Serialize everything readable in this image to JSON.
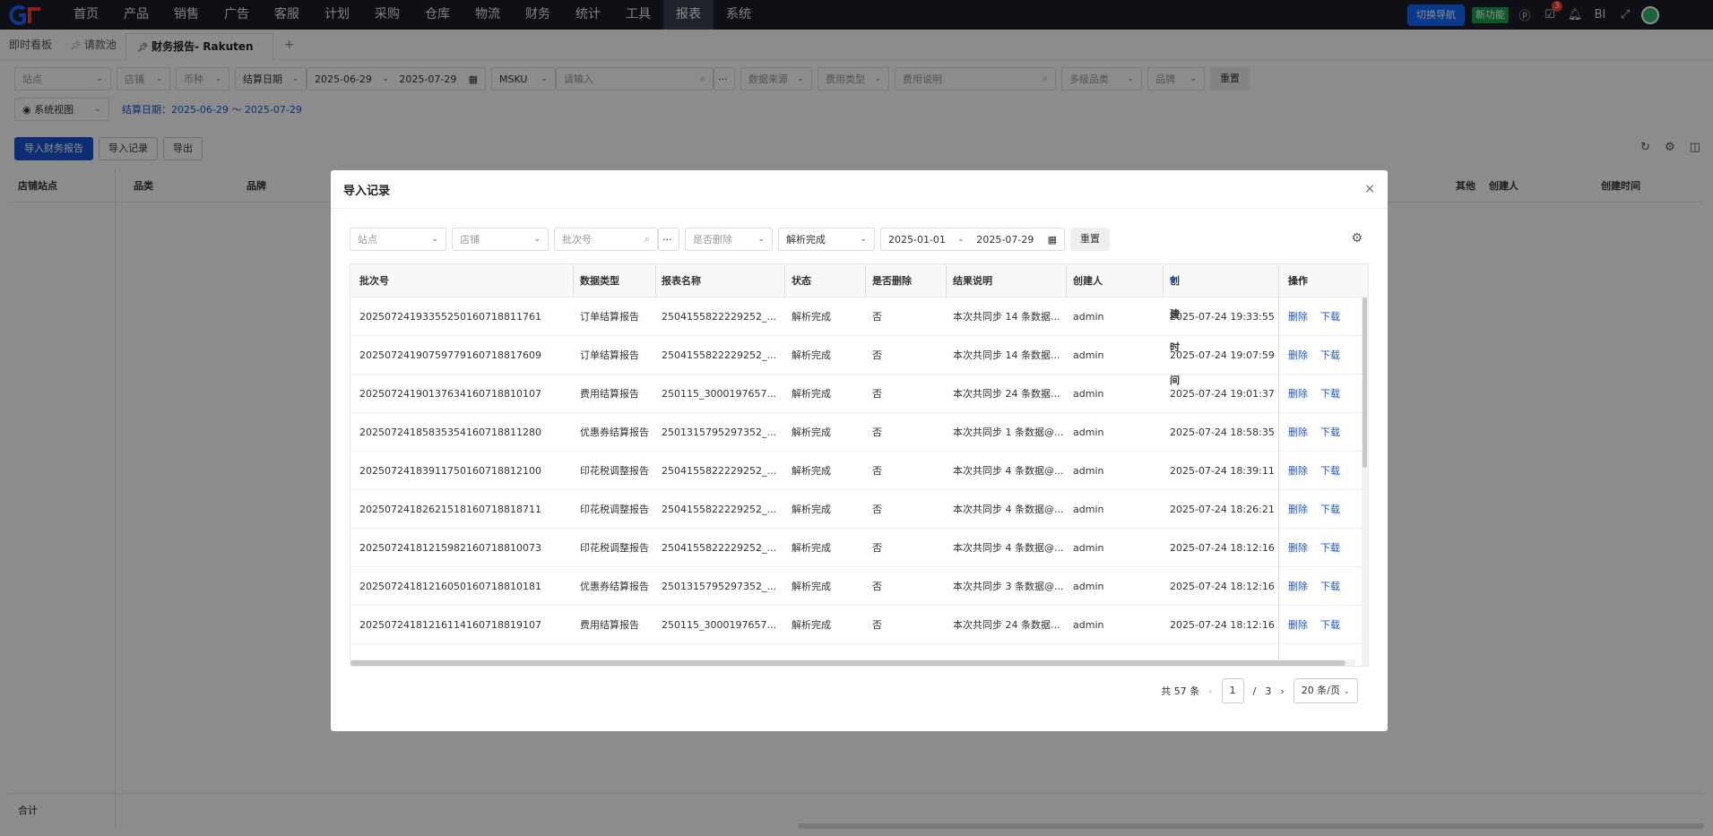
{
  "nav": {
    "items": [
      "首页",
      "产品",
      "销售",
      "广告",
      "客服",
      "计划",
      "采购",
      "仓库",
      "物流",
      "财务",
      "统计",
      "工具",
      "报表",
      "系统"
    ],
    "active": "报表",
    "switch_label": "切换导航",
    "new_label": "新功能",
    "badge_count": "3",
    "bi_label": "BI"
  },
  "tabs": {
    "items": [
      "即时看板",
      "请款池",
      "财务报告- Rakuten"
    ],
    "add": "+"
  },
  "filters": {
    "site": "站点",
    "shop": "店铺",
    "currency": "币种",
    "settle_date": "结算日期",
    "date_start": "2025-06-29",
    "date_sep": "-",
    "date_end": "2025-07-29",
    "msku": "MSKU",
    "msku_placeholder": "请输入",
    "data_source": "数据来源",
    "fee_type": "费用类型",
    "fee_desc": "费用说明",
    "category": "多级品类",
    "brand": "品牌",
    "reset": "重置",
    "system_view": "系统视图",
    "date_range_text": "结算日期：2025-06-29 ～ 2025-07-29"
  },
  "toolbar": {
    "import_report": "导入财务报告",
    "import_record": "导入记录",
    "export": "导出"
  },
  "main_table": {
    "headers": [
      "店铺站点",
      "品类",
      "品牌",
      "其他",
      "创建人",
      "创建时间"
    ],
    "sum_label": "合计"
  },
  "modal": {
    "title": "导入记录",
    "close": "×",
    "filters": {
      "site": "站点",
      "shop": "店铺",
      "batch_placeholder": "批次号",
      "is_deleted": "是否删除",
      "status": "解析完成",
      "date_start": "2025-01-01",
      "date_sep": "-",
      "date_end": "2025-07-29",
      "reset": "重置"
    },
    "headers": [
      "批次号",
      "数据类型",
      "报表名称",
      "状态",
      "是否删除",
      "结果说明",
      "创建人",
      "创建时间",
      "操作"
    ],
    "rows": [
      {
        "batch": "202507241933552501607188117​61",
        "type": "订单结算报告",
        "name": "2504155822229252_...",
        "status": "解析完成",
        "deleted": "否",
        "result": "本次共同步 14 条数据...",
        "creator": "admin",
        "time": "2025-07-24 19:33:55"
      },
      {
        "batch": "20250724190759779160718817609",
        "type": "订单结算报告",
        "name": "2504155822229252_...",
        "status": "解析完成",
        "deleted": "否",
        "result": "本次共同步 14 条数据...",
        "creator": "admin",
        "time": "2025-07-24 19:07:59"
      },
      {
        "batch": "20250724190137634160718810107",
        "type": "费用结算报告",
        "name": "250115_3000197657...",
        "status": "解析完成",
        "deleted": "否",
        "result": "本次共同步 24 条数据...",
        "creator": "admin",
        "time": "2025-07-24 19:01:37"
      },
      {
        "batch": "20250724185835354160718811280",
        "type": "优惠券结算报告",
        "name": "2501315795297352_...",
        "status": "解析完成",
        "deleted": "否",
        "result": "本次共同步 1 条数据@...",
        "creator": "admin",
        "time": "2025-07-24 18:58:35"
      },
      {
        "batch": "20250724183911750160718812100",
        "type": "印花税调整报告",
        "name": "2504155822229252_...",
        "status": "解析完成",
        "deleted": "否",
        "result": "本次共同步 4 条数据@...",
        "creator": "admin",
        "time": "2025-07-24 18:39:11"
      },
      {
        "batch": "20250724182621518160718818711",
        "type": "印花税调整报告",
        "name": "2504155822229252_...",
        "status": "解析完成",
        "deleted": "否",
        "result": "本次共同步 4 条数据@...",
        "creator": "admin",
        "time": "2025-07-24 18:26:21"
      },
      {
        "batch": "20250724181215982160718810073",
        "type": "印花税调整报告",
        "name": "2504155822229252_...",
        "status": "解析完成",
        "deleted": "否",
        "result": "本次共同步 4 条数据@...",
        "creator": "admin",
        "time": "2025-07-24 18:12:16"
      },
      {
        "batch": "20250724181216050160718810181",
        "type": "优惠券结算报告",
        "name": "2501315795297352_...",
        "status": "解析完成",
        "deleted": "否",
        "result": "本次共同步 3 条数据@...",
        "creator": "admin",
        "time": "2025-07-24 18:12:16"
      },
      {
        "batch": "20250724181216114160718819107",
        "type": "费用结算报告",
        "name": "250115_3000197657...",
        "status": "解析完成",
        "deleted": "否",
        "result": "本次共同步 24 条数据...",
        "creator": "admin",
        "time": "2025-07-24 18:12:16"
      }
    ],
    "op_delete": "删除",
    "op_download": "下载",
    "pager": {
      "total": "共 57 条",
      "prev": "‹",
      "current": "1",
      "sep": "/",
      "pages": "3",
      "next": "›",
      "page_size": "20 条/页"
    }
  },
  "colors": {
    "primary": "#1955d4",
    "nav_bg": "#1a1e27",
    "switch": "#1166ff",
    "new": "#19a04b"
  },
  "icons": [
    "logo-icon",
    "search-icon",
    "calendar-icon",
    "chevron-down-icon",
    "eye-icon",
    "pin-icon",
    "refresh-icon",
    "gear-icon",
    "columns-icon",
    "bell-icon",
    "fullscreen-icon",
    "sort-desc-icon",
    "close-icon"
  ]
}
